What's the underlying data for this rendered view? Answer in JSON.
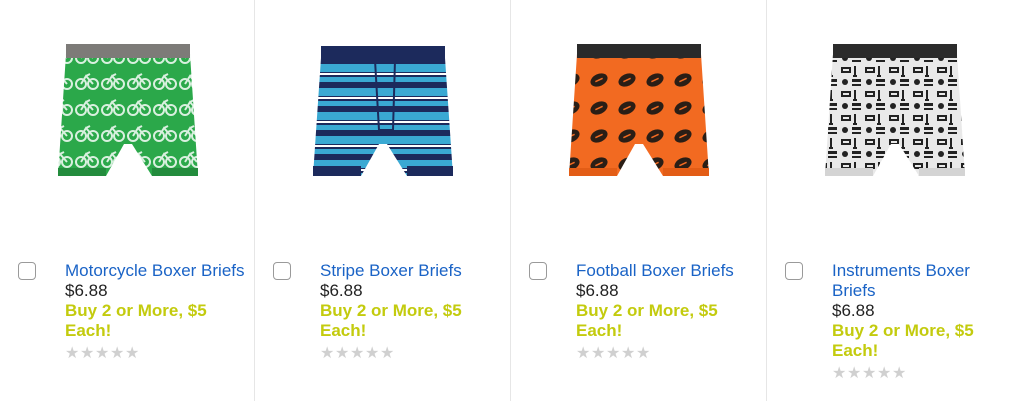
{
  "products": [
    {
      "title": "Motorcycle Boxer Briefs",
      "price": "$6.88",
      "promo": "Buy 2 or More, $5 Each!",
      "rating": 0,
      "image": "motorcycle-print-boxer-briefs",
      "colors": {
        "band": "#7d7b78",
        "body": "#2ba84a",
        "print": "#cfe9d6"
      }
    },
    {
      "title": "Stripe Boxer Briefs",
      "price": "$6.88",
      "promo": "Buy 2 or More, $5 Each!",
      "rating": 0,
      "image": "stripe-boxer-briefs",
      "colors": {
        "band": "#1c2a5c",
        "body": "#1c2a5c",
        "print": "#3aa9d3"
      }
    },
    {
      "title": "Football Boxer Briefs",
      "price": "$6.88",
      "promo": "Buy 2 or More, $5 Each!",
      "rating": 0,
      "image": "football-print-boxer-briefs",
      "colors": {
        "band": "#2a2a2a",
        "body": "#f26a21",
        "print": "#2a1e16"
      }
    },
    {
      "title": "Instruments Boxer Briefs",
      "price": "$6.88",
      "promo": "Buy 2 or More, $5 Each!",
      "rating": 0,
      "image": "instruments-print-boxer-briefs",
      "colors": {
        "band": "#2b2b2b",
        "body": "#e9e9e9",
        "print": "#222222"
      }
    }
  ],
  "theme": {
    "link": "#1a63c6",
    "promo": "#c3cb0e",
    "star_empty": "#d0d0d0"
  }
}
